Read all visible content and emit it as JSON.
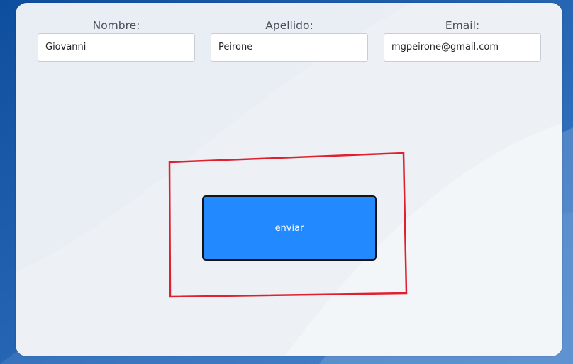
{
  "form": {
    "fields": [
      {
        "label": "Nombre:",
        "value": "Giovanni"
      },
      {
        "label": "Apellido:",
        "value": "Peirone"
      },
      {
        "label": "Email:",
        "value": "mgpeirone@gmail.com"
      }
    ],
    "submit_label": "enviar"
  },
  "colors": {
    "page_background": "#1a5ca8",
    "card_background": "#e9eef5",
    "button": "#2389ff",
    "highlight_box": "#e0202e"
  }
}
